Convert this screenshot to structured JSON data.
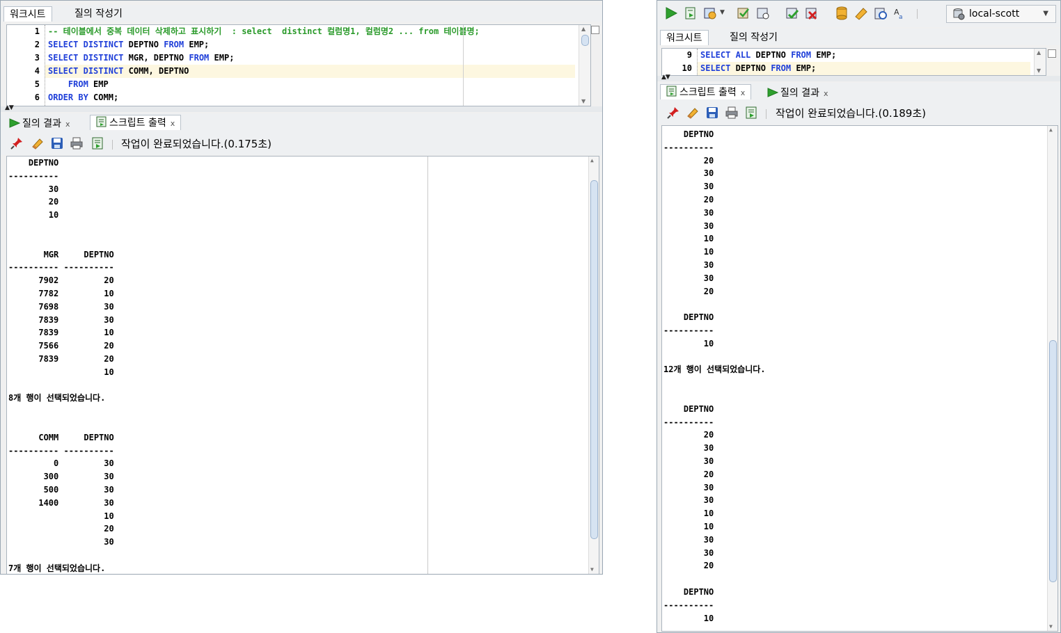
{
  "left": {
    "tabs": {
      "worksheet": "워크시트",
      "query_builder": "질의 작성기"
    },
    "editor_lines": [
      {
        "num": "1",
        "text": "-- 테이블에서 중복 데이터 삭제하고 표시하기  : select  distinct 컬럼명1, 컬럼명2 ... from 테이블명;"
      },
      {
        "num": "2",
        "text": "SELECT DISTINCT DEPTNO FROM EMP;"
      },
      {
        "num": "3",
        "text": "SELECT DISTINCT MGR, DEPTNO FROM EMP;"
      },
      {
        "num": "4",
        "text": "SELECT DISTINCT COMM, DEPTNO"
      },
      {
        "num": "5",
        "text": "    FROM EMP"
      },
      {
        "num": "6",
        "text": "ORDER BY COMM;"
      }
    ],
    "output_tabs": {
      "query_result": "질의 결과",
      "script_output": "스크립트 출력",
      "close": "x"
    },
    "status": "작업이 완료되었습니다.(0.175초)",
    "output_lines": [
      "    DEPTNO",
      "----------",
      "        30",
      "        20",
      "        10",
      "",
      "",
      "       MGR     DEPTNO",
      "---------- ----------",
      "      7902         20",
      "      7782         10",
      "      7698         30",
      "      7839         30",
      "      7839         10",
      "      7566         20",
      "      7839         20",
      "                   10",
      "",
      "8개 행이 선택되었습니다.",
      "",
      "",
      "      COMM     DEPTNO",
      "---------- ----------",
      "         0         30",
      "       300         30",
      "       500         30",
      "      1400         30",
      "                   10",
      "                   20",
      "                   30",
      "",
      "7개 행이 선택되었습니다."
    ]
  },
  "right": {
    "connection": "local-scott",
    "tabs": {
      "worksheet": "워크시트",
      "query_builder": "질의 작성기"
    },
    "editor_lines": [
      {
        "num": "9",
        "text": "SELECT ALL DEPTNO FROM EMP;"
      },
      {
        "num": "10",
        "text": "SELECT DEPTNO FROM EMP;"
      }
    ],
    "output_tabs": {
      "script_output": "스크립트 출력",
      "query_result": "질의 결과",
      "close": "x"
    },
    "status": "작업이 완료되었습니다.(0.189초)",
    "output_lines": [
      "    DEPTNO",
      "----------",
      "        20",
      "        30",
      "        30",
      "        20",
      "        30",
      "        30",
      "        10",
      "        10",
      "        30",
      "        30",
      "        20",
      "",
      "    DEPTNO",
      "----------",
      "        10",
      "",
      "12개 행이 선택되었습니다.",
      "",
      "",
      "    DEPTNO",
      "----------",
      "        20",
      "        30",
      "        30",
      "        20",
      "        30",
      "        30",
      "        10",
      "        10",
      "        30",
      "        30",
      "        20",
      "",
      "    DEPTNO",
      "----------",
      "        10"
    ]
  },
  "colors": {
    "keyword": "#1f3fd9",
    "comment": "#2a9a2a",
    "run_green": "#2ea02e",
    "pin_red": "#d22020"
  },
  "icons": [
    "run-icon",
    "run-script-icon",
    "sql-tuning-icon",
    "commit-icon",
    "rollback-icon",
    "autotrace-icon",
    "explain-plan-icon",
    "clear-icon",
    "history-icon",
    "format-icon",
    "database-icon",
    "pin-icon",
    "eraser-icon",
    "save-icon",
    "print-icon",
    "script-icon"
  ]
}
